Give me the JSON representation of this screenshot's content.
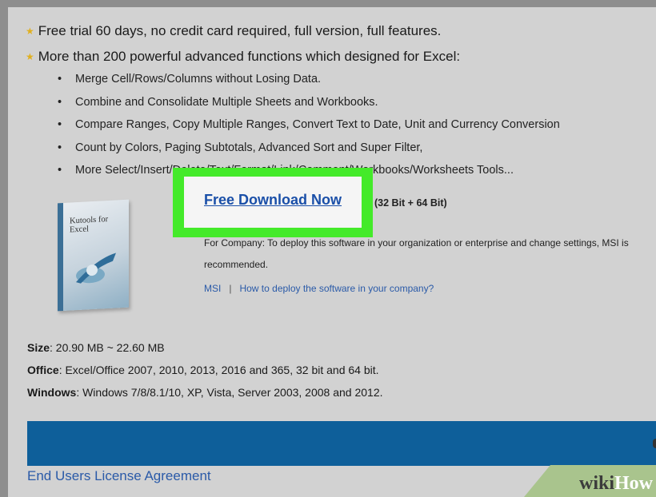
{
  "features": [
    "Free trial 60 days, no credit card required, full version, full features.",
    "More than 200 powerful advanced functions which designed for Excel:"
  ],
  "bullets": [
    "Merge Cell/Rows/Columns without Losing Data.",
    "Combine and Consolidate Multiple Sheets and Workbooks.",
    "Compare Ranges, Copy Multiple Ranges, Convert Text to Date, Unit and Currency Conversion",
    "Count by Colors, Paging Subtotals, Advanced Sort and Super Filter,",
    "More Select/Insert/Delete/Text/Format/Link/Comment/Workbooks/Worksheets Tools..."
  ],
  "product_box": {
    "title": "Kutools for Excel"
  },
  "download": {
    "link": "Free Download Now",
    "bits": "(32 Bit + 64 Bit)",
    "company_note": "For Company: To deploy this software in your organization or enterprise and change settings, MSI is",
    "recommended": "recommended.",
    "msi_link": "MSI",
    "separator": "|",
    "deploy_link": "How to deploy the software in your company?"
  },
  "specs": {
    "size_label": "Size",
    "size_value": ": 20.90 MB ~ 22.60 MB",
    "office_label": "Office",
    "office_value": ": Excel/Office 2007, 2010, 2013, 2016 and 365, 32 bit and 64 bit.",
    "windows_label": "Windows",
    "windows_value": ": Windows 7/8/8.1/10, XP, Vista, Server 2003, 2008 and 2012."
  },
  "eula_link": "End Users License Agreement",
  "watermark": {
    "part1": "wiki",
    "part2": "How"
  },
  "colors": {
    "highlight": "#44ea2a",
    "link": "#1a4fa8",
    "bar": "#0e5f9a"
  }
}
